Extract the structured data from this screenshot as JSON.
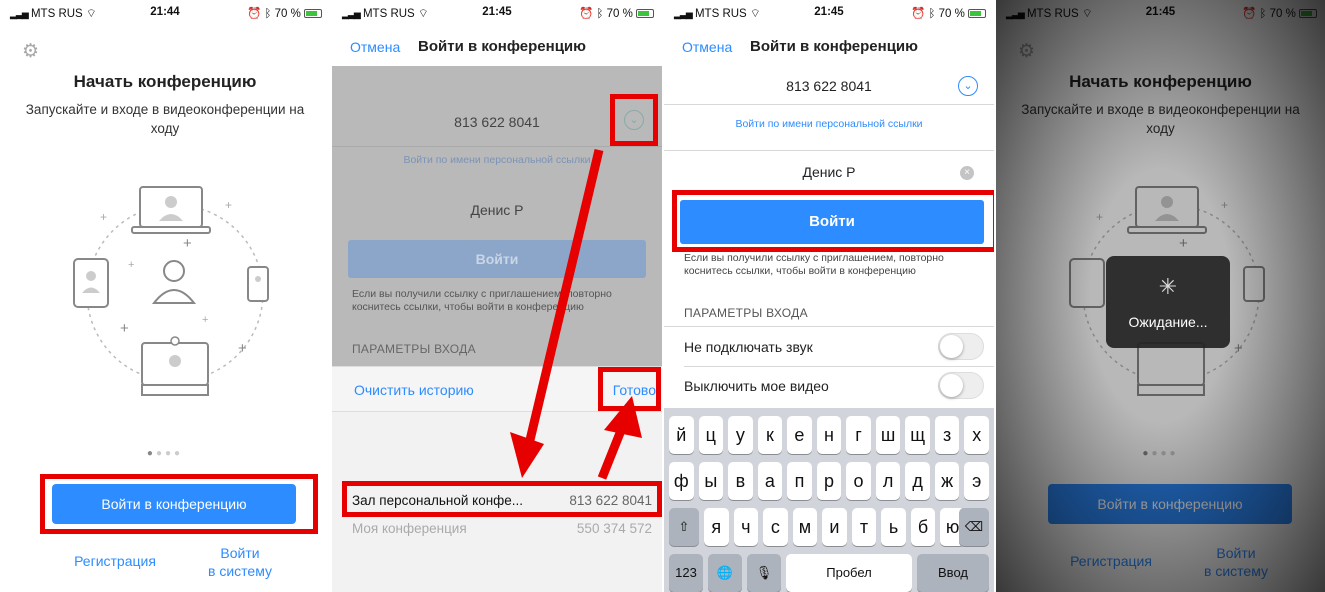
{
  "status": {
    "carrier": "MTS RUS",
    "screen1_time": "21:44",
    "screen_time": "21:45",
    "battery": "70 %"
  },
  "start": {
    "title": "Начать конференцию",
    "subtitle": "Запускайте и входе в видеоконференции на ходу",
    "join_button": "Войти в конференцию",
    "signup_link": "Регистрация",
    "signin_link_line1": "Войти",
    "signin_link_line2": "в систему"
  },
  "join": {
    "cancel": "Отмена",
    "title": "Войти в конференцию",
    "meeting_id": "813 622 8041",
    "personal_link": "Войти по имени персональной ссылки",
    "name": "Денис Р",
    "join_button": "Войти",
    "hint": "Если вы получили ссылку с приглашением, повторно коснитесь ссылки, чтобы войти в конференцию",
    "section_label": "ПАРАМЕТРЫ ВХОДА",
    "opt_no_audio": "Не подключать звук",
    "opt_no_video": "Выключить мое видео"
  },
  "picker": {
    "clear_history": "Очистить историю",
    "done": "Готово",
    "items": [
      {
        "name": "Зал персональной конфе...",
        "id": "813 622 8041"
      },
      {
        "name": "Моя конференция",
        "id": "550 374 572"
      }
    ]
  },
  "keyboard": {
    "row1": [
      "й",
      "ц",
      "у",
      "к",
      "е",
      "н",
      "г",
      "ш",
      "щ",
      "з",
      "х"
    ],
    "row2": [
      "ф",
      "ы",
      "в",
      "а",
      "п",
      "р",
      "о",
      "л",
      "д",
      "ж",
      "э"
    ],
    "row3": [
      "я",
      "ч",
      "с",
      "м",
      "и",
      "т",
      "ь",
      "б",
      "ю"
    ],
    "shift": "⇧",
    "backspace": "⌫",
    "numbers": "123",
    "globe": "🌐",
    "mic": "🎙",
    "space": "Пробел",
    "enter": "Ввод"
  },
  "waiting": {
    "label": "Ожидание..."
  },
  "colors": {
    "accent": "#2d8cff",
    "annotation_red": "#e60000"
  }
}
